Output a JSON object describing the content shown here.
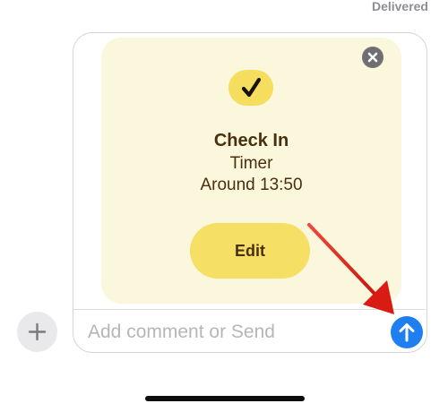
{
  "status": {
    "delivered": "Delivered"
  },
  "checkin_card": {
    "title": "Check In",
    "mode": "Timer",
    "eta": "Around 13:50",
    "edit_label": "Edit",
    "badge_icon": "checkmark-icon",
    "close_icon": "close-icon",
    "badge_color": "#f5de5e",
    "card_color": "#fbf7dc",
    "text_color": "#4a2f0f"
  },
  "composer": {
    "placeholder": "Add comment or Send",
    "plus_icon": "plus-icon",
    "send_icon": "send-arrow-up-icon",
    "send_color": "#1f7ef0"
  },
  "annotation": {
    "arrow_color": "#e3231b",
    "arrow_icon": "pointer-arrow"
  }
}
